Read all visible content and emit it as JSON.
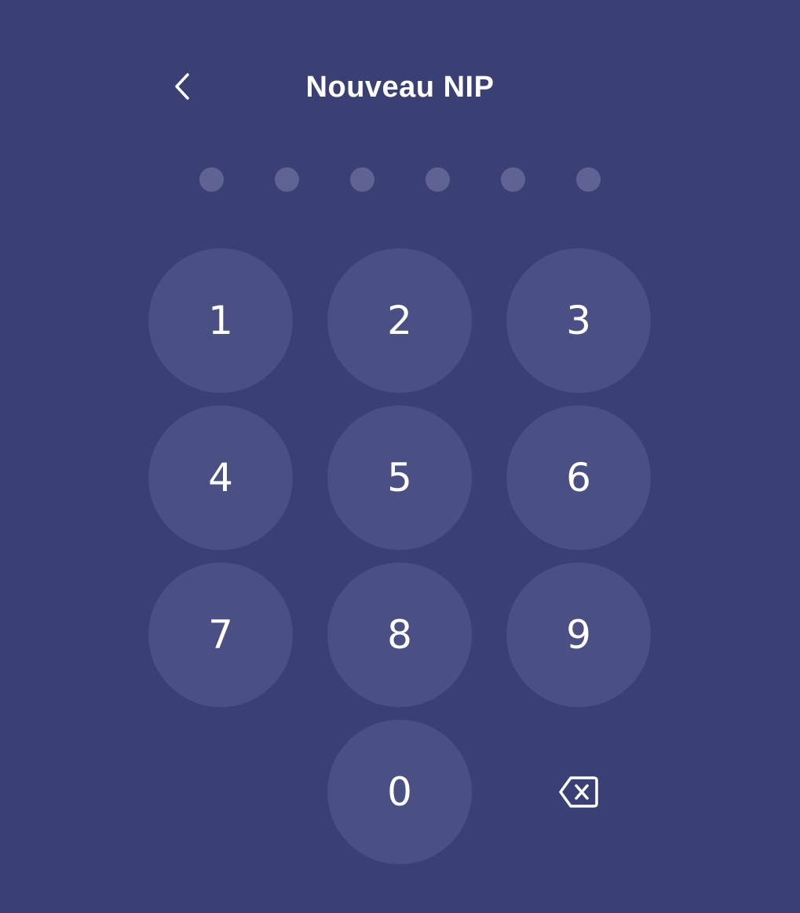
{
  "header": {
    "title": "Nouveau NIP",
    "back_icon": "chevron-left-icon"
  },
  "pin": {
    "length": 6,
    "filled": 0
  },
  "keypad": {
    "keys": [
      "1",
      "2",
      "3",
      "4",
      "5",
      "6",
      "7",
      "8",
      "9",
      "0"
    ],
    "backspace_icon": "backspace-icon"
  },
  "colors": {
    "background": "#3b4074",
    "key": "#4a4f84",
    "dot_empty": "#5f6394",
    "text": "#ffffff"
  }
}
